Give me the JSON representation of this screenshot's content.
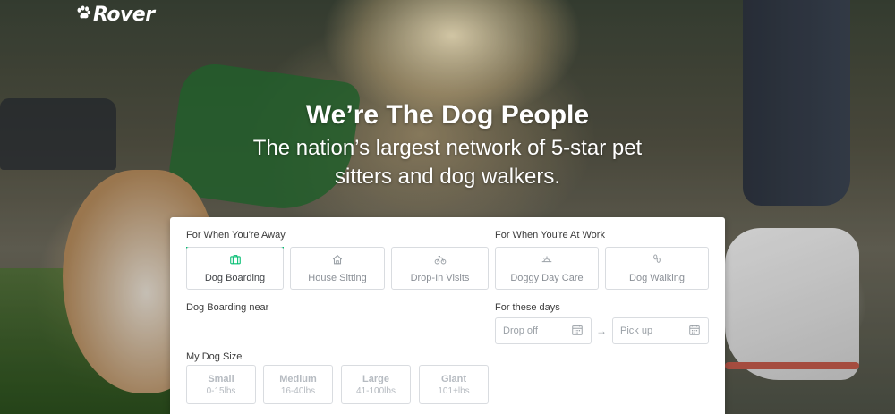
{
  "brand": {
    "name": "Rover",
    "logo_icon": "paw-icon"
  },
  "hero": {
    "title": "We’re The Dog People",
    "subtitle": "The nation’s largest network of 5-star pet sitters and dog walkers."
  },
  "search": {
    "away_label": "For When You're Away",
    "work_label": "For When You're At Work",
    "services_away": [
      {
        "label": "Dog Boarding",
        "icon": "suitcase-icon",
        "active": true
      },
      {
        "label": "House Sitting",
        "icon": "house-icon",
        "active": false
      },
      {
        "label": "Drop-In Visits",
        "icon": "bike-icon",
        "active": false
      }
    ],
    "services_work": [
      {
        "label": "Doggy Day Care",
        "icon": "sun-icon",
        "active": false
      },
      {
        "label": "Dog Walking",
        "icon": "leash-icon",
        "active": false
      }
    ],
    "near_label": "Dog Boarding near",
    "days_label": "For these days",
    "drop_off_placeholder": "Drop off",
    "pick_up_placeholder": "Pick up",
    "date_arrow": "→",
    "size_label": "My Dog Size",
    "sizes": [
      {
        "name": "Small",
        "range": "0-15lbs"
      },
      {
        "name": "Medium",
        "range": "16-40lbs"
      },
      {
        "name": "Large",
        "range": "41-100lbs"
      },
      {
        "name": "Giant",
        "range": "101+lbs"
      }
    ]
  },
  "colors": {
    "accent": "#00bd70",
    "border": "#d9dce0"
  }
}
